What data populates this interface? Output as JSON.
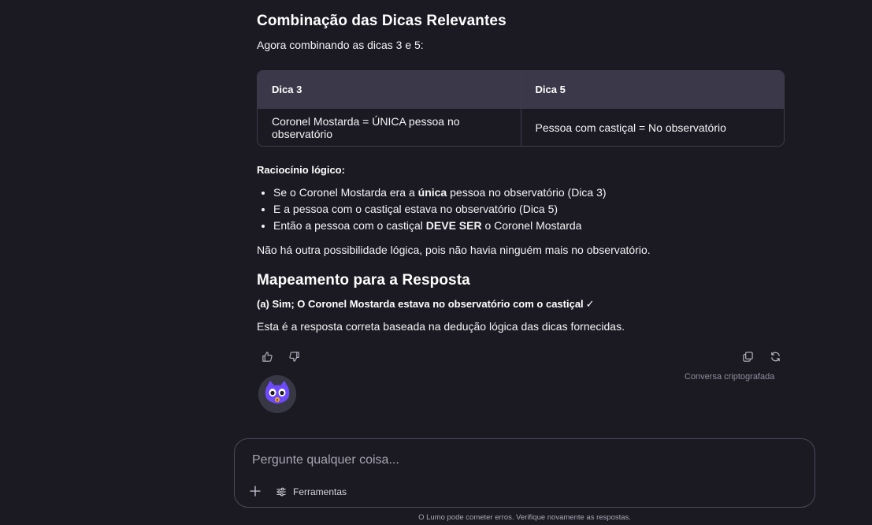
{
  "message": {
    "heading_combination": "Combinação das Dicas Relevantes",
    "intro": "Agora combinando as dicas 3 e 5:",
    "table": {
      "headers": [
        "Dica 3",
        "Dica 5"
      ],
      "rows": [
        [
          "Coronel Mostarda = ÚNICA pessoa no observatório",
          "Pessoa com castiçal = No observatório"
        ]
      ]
    },
    "reasoning_label": "Raciocínio lógico:",
    "bullets": [
      {
        "a": "Se o Coronel Mostarda era a ",
        "b": "única",
        "c": " pessoa no observatório (Dica 3)"
      },
      {
        "a": "E a pessoa com o castiçal estava no observatório (Dica 5)",
        "b": "",
        "c": ""
      },
      {
        "a": "Então a pessoa com o castiçal ",
        "b": "DEVE SER",
        "c": " o Coronel Mostarda"
      }
    ],
    "conclusion": "Não há outra possibilidade lógica, pois não havia ninguém mais no observatório.",
    "heading_mapping": "Mapeamento para a Resposta",
    "answer": "(a) Sim; O Coronel Mostarda estava no observatório com o castiçal",
    "answer_check": "✓",
    "final": "Esta é a resposta correta baseada na dedução lógica das dicas fornecidas."
  },
  "actions": {
    "thumbs_up_icon": "thumbs-up-icon",
    "thumbs_down_icon": "thumbs-down-icon",
    "copy_icon": "copy-icon",
    "regenerate_icon": "refresh-icon",
    "encrypted_label": "Conversa criptografada"
  },
  "composer": {
    "placeholder": "Pergunte qualquer coisa...",
    "tools_label": "Ferramentas"
  },
  "footer": {
    "disclaimer": "O Lumo pode cometer erros. Verifique novamente as respostas."
  },
  "colors": {
    "background": "#1b1a23",
    "table_header": "#3b3949",
    "border": "#3d3b4a",
    "avatar_purple": "#6d4aff"
  }
}
